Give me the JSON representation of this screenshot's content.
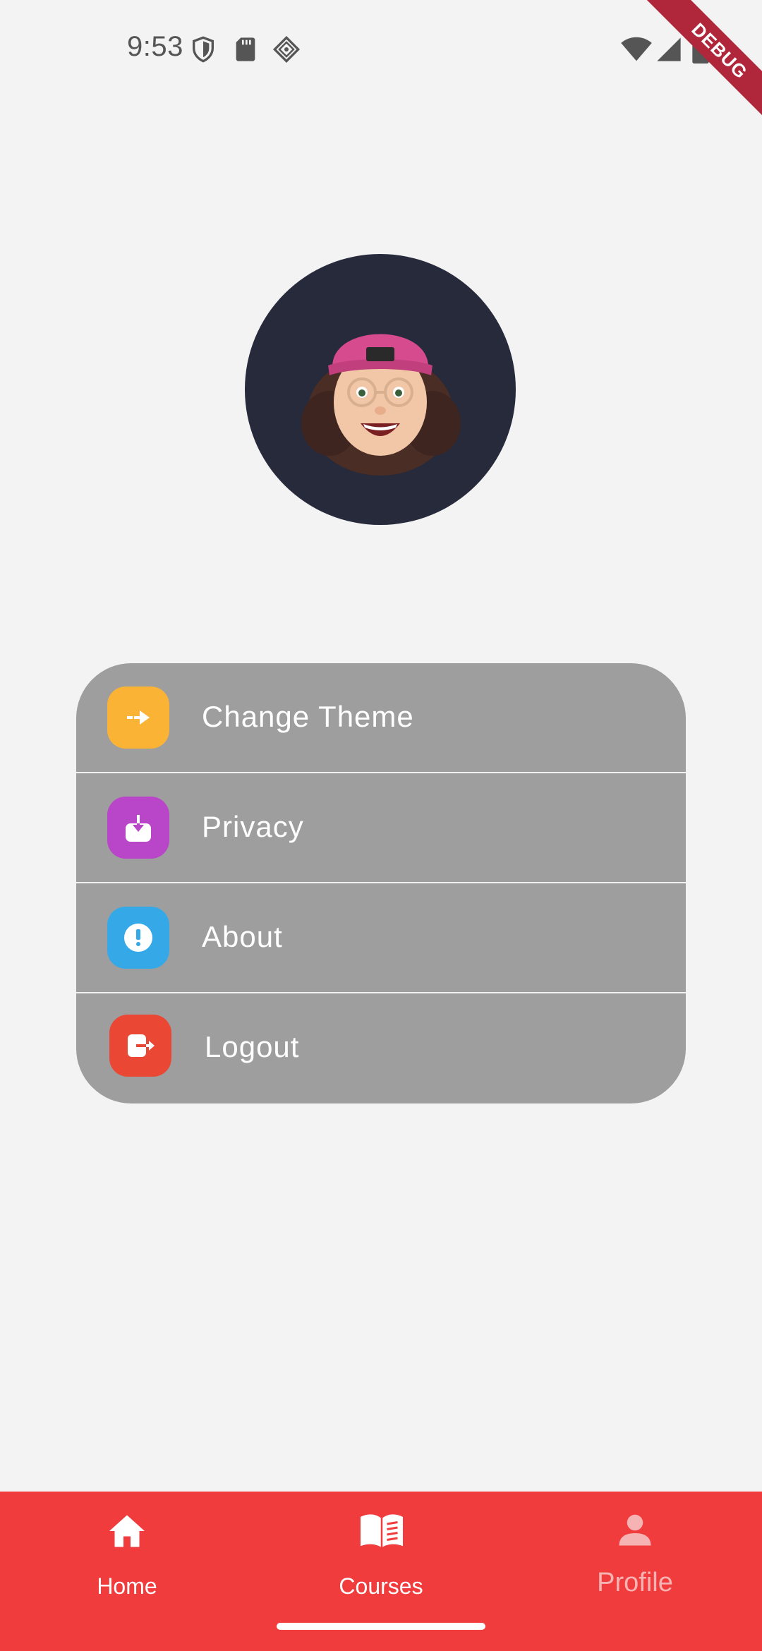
{
  "status_bar": {
    "time": "9:53",
    "icons_left": [
      "shield-icon",
      "sd-card-icon",
      "network-diamond-icon"
    ],
    "icons_right": [
      "wifi-icon",
      "cell-signal-icon",
      "battery-icon"
    ]
  },
  "debug_banner": {
    "label": "DEBUG",
    "color": "#b0263a"
  },
  "profile": {
    "avatar": "memoji-avatar",
    "avatar_bg": "#262a3b"
  },
  "menu": {
    "background": "#9e9e9e",
    "items": [
      {
        "label": "Change Theme",
        "icon": "enter-arrow-icon",
        "icon_color": "#fbb336"
      },
      {
        "label": "Privacy",
        "icon": "download-box-icon",
        "icon_color": "#b945c9"
      },
      {
        "label": "About",
        "icon": "info-alert-icon",
        "icon_color": "#35a9e8"
      },
      {
        "label": "Logout",
        "icon": "logout-icon",
        "icon_color": "#eb4735"
      }
    ]
  },
  "bottom_nav": {
    "background": "#f03c3c",
    "items": [
      {
        "label": "Home",
        "icon": "home-icon",
        "active": true
      },
      {
        "label": "Courses",
        "icon": "book-icon",
        "active": true
      },
      {
        "label": "Profile",
        "icon": "person-icon",
        "active": false
      }
    ]
  }
}
